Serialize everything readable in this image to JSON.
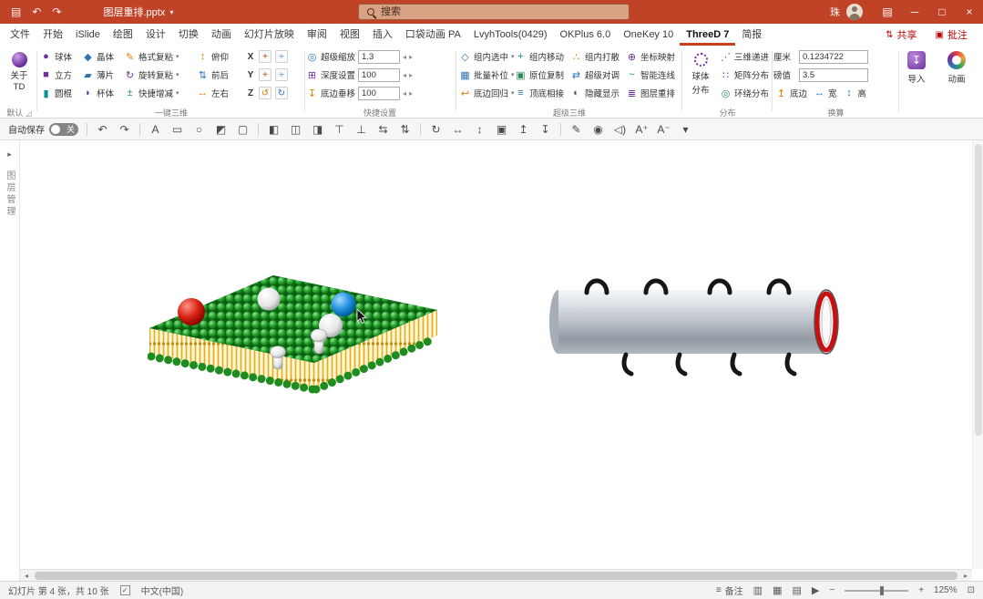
{
  "colors": {
    "titlebar_bg": "#C04227",
    "accent_red": "#C00000",
    "active_tab_underline": "#C8401E",
    "purple": "#7030A0",
    "blue": "#2E74B5",
    "teal": "#009595",
    "green": "#2E8B57",
    "orange": "#E07B00"
  },
  "titlebar": {
    "qat_icons": [
      {
        "name": "save-icon",
        "glyph": "▤"
      },
      {
        "name": "undo-icon",
        "glyph": "↶"
      },
      {
        "name": "redo-icon",
        "glyph": "↷"
      }
    ],
    "title": "图层重排.pptx",
    "caret": "▾",
    "search_placeholder": "搜索",
    "user_name": "珠",
    "ribbon_options_glyph": "▤",
    "minimize": "─",
    "maximize": "□",
    "close": "×"
  },
  "tabs": {
    "items": [
      "文件",
      "开始",
      "iSlide",
      "绘图",
      "设计",
      "切换",
      "动画",
      "幻灯片放映",
      "审阅",
      "视图",
      "插入",
      "口袋动画 PA",
      "LvyhTools(0429)",
      "OKPlus 6.0",
      "OneKey 10",
      "ThreeD 7",
      "简报"
    ],
    "active": "ThreeD 7",
    "share_glyph": "⇅",
    "share": "共享",
    "comments_glyph": "▣",
    "comments": "批注"
  },
  "ribbon": {
    "about": {
      "line1": "关于",
      "line2": "TD",
      "group_label": "默认",
      "launcher_glyph": "◿"
    },
    "onekey": {
      "group_label": "一键三维",
      "shapes": [
        {
          "label": "球体",
          "glyph": "●",
          "color": "#7030A0"
        },
        {
          "label": "晶体",
          "glyph": "◆",
          "color": "#2E74B5"
        },
        {
          "label": "立方",
          "glyph": "■",
          "color": "#7030A0"
        },
        {
          "label": "薄片",
          "glyph": "▰",
          "color": "#2E74B5"
        },
        {
          "label": "圆棍",
          "glyph": "▮",
          "color": "#009595"
        },
        {
          "label": "杯体",
          "glyph": "◗",
          "color": "#7030A0"
        }
      ],
      "paste": [
        {
          "label": "格式复粘",
          "glyph": "✎",
          "color": "#E07B00",
          "caret": "▾"
        },
        {
          "label": "旋转复粘",
          "glyph": "↻",
          "color": "#7030A0",
          "caret": "▾"
        },
        {
          "label": "快捷增减",
          "glyph": "±",
          "color": "#2E8B57",
          "caret": "▾"
        }
      ],
      "orient": [
        {
          "label": "俯仰",
          "glyph": "↕",
          "color": "#E07B00"
        },
        {
          "label": "前后",
          "glyph": "⇅",
          "color": "#2E74B5"
        },
        {
          "label": "左右",
          "glyph": "↔",
          "color": "#E07B00"
        }
      ],
      "axes": [
        {
          "axis": "X",
          "plus": "+",
          "plus_color": "#D03A20",
          "divide": "÷",
          "divide_color": "#2E74B5"
        },
        {
          "axis": "Y",
          "plus": "+",
          "plus_color": "#D03A20",
          "divide": "÷",
          "divide_color": "#2E74B5"
        },
        {
          "axis": "Z",
          "plus": "↺",
          "plus_color": "#E07B00",
          "divide": "↻",
          "divide_color": "#2E74B5"
        }
      ]
    },
    "quick": {
      "group_label": "快捷设置",
      "spin_left": "◂",
      "spin_right": "▸",
      "rows": [
        {
          "icon_glyph": "◎",
          "icon_color": "#2E74B5",
          "label": "超级缩放",
          "value": "1.3"
        },
        {
          "icon_glyph": "⊞",
          "icon_color": "#7030A0",
          "label": "深度设置",
          "value": "100"
        },
        {
          "icon_glyph": "↧",
          "icon_color": "#E07B00",
          "label": "底边垂移",
          "value": "100"
        }
      ]
    },
    "super3d": {
      "group_label": "超级三维",
      "items": [
        {
          "label": "组内选中",
          "glyph": "◇",
          "color": "#2E74B5",
          "caret": "▾"
        },
        {
          "label": "组内移动",
          "glyph": "+",
          "color": "#009595"
        },
        {
          "label": "组内打散",
          "glyph": "∴",
          "color": "#E07B00"
        },
        {
          "label": "坐标映射",
          "glyph": "⊕",
          "color": "#7030A0"
        },
        {
          "label": "批量补位",
          "glyph": "▦",
          "color": "#2E74B5",
          "caret": "▾"
        },
        {
          "label": "原位复制",
          "glyph": "▣",
          "color": "#2E8B57"
        },
        {
          "label": "超级对调",
          "glyph": "⇄",
          "color": "#2E74B5"
        },
        {
          "label": "智能连线",
          "glyph": "~",
          "color": "#009595"
        },
        {
          "label": "底边回归",
          "glyph": "↩",
          "color": "#E07B00",
          "caret": "▾"
        },
        {
          "label": "顶底相接",
          "glyph": "≡",
          "color": "#2E74B5"
        },
        {
          "label": "隐藏显示",
          "glyph": "◐",
          "color": "#595959"
        },
        {
          "label": "图层重排",
          "glyph": "≣",
          "color": "#7030A0"
        }
      ]
    },
    "distribute": {
      "group_label": "分布",
      "big_line1": "球体",
      "big_line2": "分布",
      "items": [
        {
          "label": "三维递进",
          "glyph": "⋰",
          "color": "#2E74B5"
        },
        {
          "label": "矩阵分布",
          "glyph": "∷",
          "color": "#7030A0"
        },
        {
          "label": "环绕分布",
          "glyph": "◎",
          "color": "#2E8B57"
        }
      ]
    },
    "convert": {
      "group_label": "换算",
      "rows": [
        {
          "label": "厘米",
          "value": "0.1234722"
        },
        {
          "label": "磅值",
          "value": "3.5"
        }
      ],
      "mini": [
        {
          "glyph": "↥",
          "label": "底边",
          "color": "#E07B00"
        },
        {
          "glyph": "↔",
          "label": "宽",
          "color": "#2E74B5"
        },
        {
          "glyph": "↕",
          "label": "高",
          "color": "#2E74B5"
        }
      ]
    },
    "tools": {
      "import_glyph": "↧",
      "import_label": "导入",
      "anim_label": "动画"
    }
  },
  "qat": {
    "autosave_label": "自动保存",
    "autosave_state": "关",
    "more_glyph": "▾",
    "icons": [
      {
        "name": "undo-icon",
        "glyph": "↶"
      },
      {
        "name": "redo-icon",
        "glyph": "↷"
      },
      {
        "name": "text-box-icon",
        "glyph": "A"
      },
      {
        "name": "shape-rectangle-icon",
        "glyph": "▭"
      },
      {
        "name": "shape-oval-icon",
        "glyph": "○"
      },
      {
        "name": "fill-color-icon",
        "glyph": "◩"
      },
      {
        "name": "outline-color-icon",
        "glyph": "▢"
      },
      {
        "name": "align-left-icon",
        "glyph": "◧"
      },
      {
        "name": "align-center-icon",
        "glyph": "◫"
      },
      {
        "name": "align-right-icon",
        "glyph": "◨"
      },
      {
        "name": "align-top-icon",
        "glyph": "⊤"
      },
      {
        "name": "align-bottom-icon",
        "glyph": "⊥"
      },
      {
        "name": "distribute-horizontal-icon",
        "glyph": "⇆"
      },
      {
        "name": "distribute-vertical-icon",
        "glyph": "⇅"
      },
      {
        "name": "rotate-icon",
        "glyph": "↻"
      },
      {
        "name": "flip-horizontal-icon",
        "glyph": "↔"
      },
      {
        "name": "flip-vertical-icon",
        "glyph": "↕"
      },
      {
        "name": "group-icon",
        "glyph": "▣"
      },
      {
        "name": "bring-forward-icon",
        "glyph": "↥"
      },
      {
        "name": "send-backward-icon",
        "glyph": "↧"
      },
      {
        "name": "eyedropper-icon",
        "glyph": "✎"
      },
      {
        "name": "three-d-shape-icon",
        "glyph": "◉"
      },
      {
        "name": "audio-icon",
        "glyph": "◁)"
      },
      {
        "name": "font-increase-icon",
        "glyph": "A⁺"
      },
      {
        "name": "font-decrease-icon",
        "glyph": "A⁻"
      }
    ]
  },
  "sidebar": {
    "collapse_glyph": "▸",
    "panel_label": "图层管理"
  },
  "hscroll": {
    "left_glyph": "◂",
    "right_glyph": "▸"
  },
  "statusbar": {
    "slide_info": "幻灯片 第 4 张，共 10 张",
    "spell_glyph": "✓",
    "language": "中文(中国)",
    "notes_glyph": "≡",
    "notes_label": "备注",
    "view_icons": [
      {
        "name": "normal-view-icon",
        "glyph": "▥"
      },
      {
        "name": "slide-sorter-icon",
        "glyph": "▦"
      },
      {
        "name": "reading-view-icon",
        "glyph": "▤"
      },
      {
        "name": "slideshow-icon",
        "glyph": "▶"
      }
    ],
    "zoom_minus": "−",
    "zoom_plus": "+",
    "zoom_percent": "125%",
    "fit_glyph": "⊡"
  }
}
